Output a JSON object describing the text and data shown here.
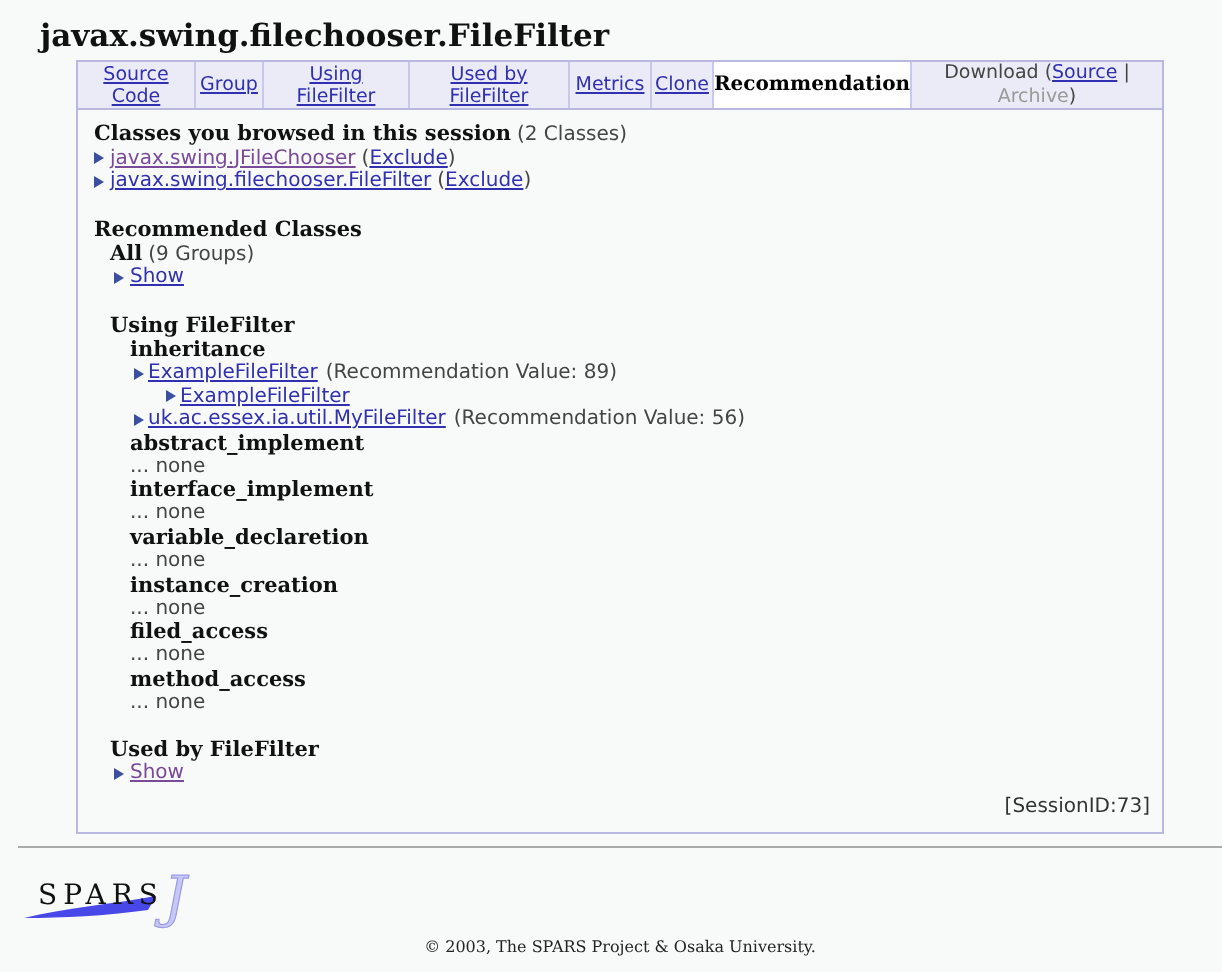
{
  "title": "javax.swing.filechooser.FileFilter",
  "tabs": [
    {
      "kind": "link",
      "label": "Source Code",
      "selected": false
    },
    {
      "kind": "link",
      "label": "Group",
      "selected": false
    },
    {
      "kind": "link",
      "label": "Using FileFilter",
      "selected": false
    },
    {
      "kind": "link",
      "label": "Used by FileFilter",
      "selected": false
    },
    {
      "kind": "link",
      "label": "Metrics",
      "selected": false
    },
    {
      "kind": "link",
      "label": "Clone",
      "selected": false
    },
    {
      "kind": "link",
      "label": "Recommendation",
      "selected": true
    },
    {
      "kind": "parts",
      "selected": false,
      "parts": [
        {
          "kind": "plain",
          "text": "Download ("
        },
        {
          "kind": "link",
          "text": "Source"
        },
        {
          "kind": "plain",
          "text": " |"
        },
        {
          "kind": "disabled",
          "text": "Archive"
        },
        {
          "kind": "plain",
          "text": ")"
        }
      ]
    }
  ],
  "session": {
    "heading": "Classes you browsed in this session",
    "count": "(2 Classes)",
    "items": [
      {
        "name": "javax.swing.JFileChooser",
        "visited": true,
        "open": "(",
        "action": "Exclude",
        "close": ")"
      },
      {
        "name": "javax.swing.filechooser.FileFilter",
        "visited": false,
        "open": "(",
        "action": "Exclude",
        "close": ")"
      }
    ]
  },
  "recommended": {
    "heading": "Recommended Classes",
    "groups": [
      {
        "title": "All",
        "count": "(9 Groups)",
        "show": "Show",
        "visited": false
      },
      {
        "title": "Using FileFilter",
        "categories": [
          {
            "name": "inheritance",
            "results": [
              {
                "name": "ExampleFileFilter",
                "value": "(Recommendation Value: 89)",
                "children": [
                  {
                    "name": "ExampleFileFilter"
                  }
                ]
              },
              {
                "name": "uk.ac.essex.ia.util.MyFileFilter",
                "value": "(Recommendation Value: 56)"
              }
            ]
          },
          {
            "name": "abstract_implement",
            "empty": "... none"
          },
          {
            "name": "interface_implement",
            "empty": "... none"
          },
          {
            "name": "variable_declaretion",
            "empty": "... none"
          },
          {
            "name": "instance_creation",
            "empty": "... none"
          },
          {
            "name": "filed_access",
            "empty": "... none"
          },
          {
            "name": "method_access",
            "empty": "... none"
          }
        ]
      },
      {
        "title": "Used by FileFilter",
        "show": "Show",
        "visited": true
      }
    ]
  },
  "session_id": "[SessionID:73]",
  "logo": {
    "text": "SPARS",
    "mark": "J"
  },
  "footer": "© 2003, The SPARS Project & Osaka University."
}
